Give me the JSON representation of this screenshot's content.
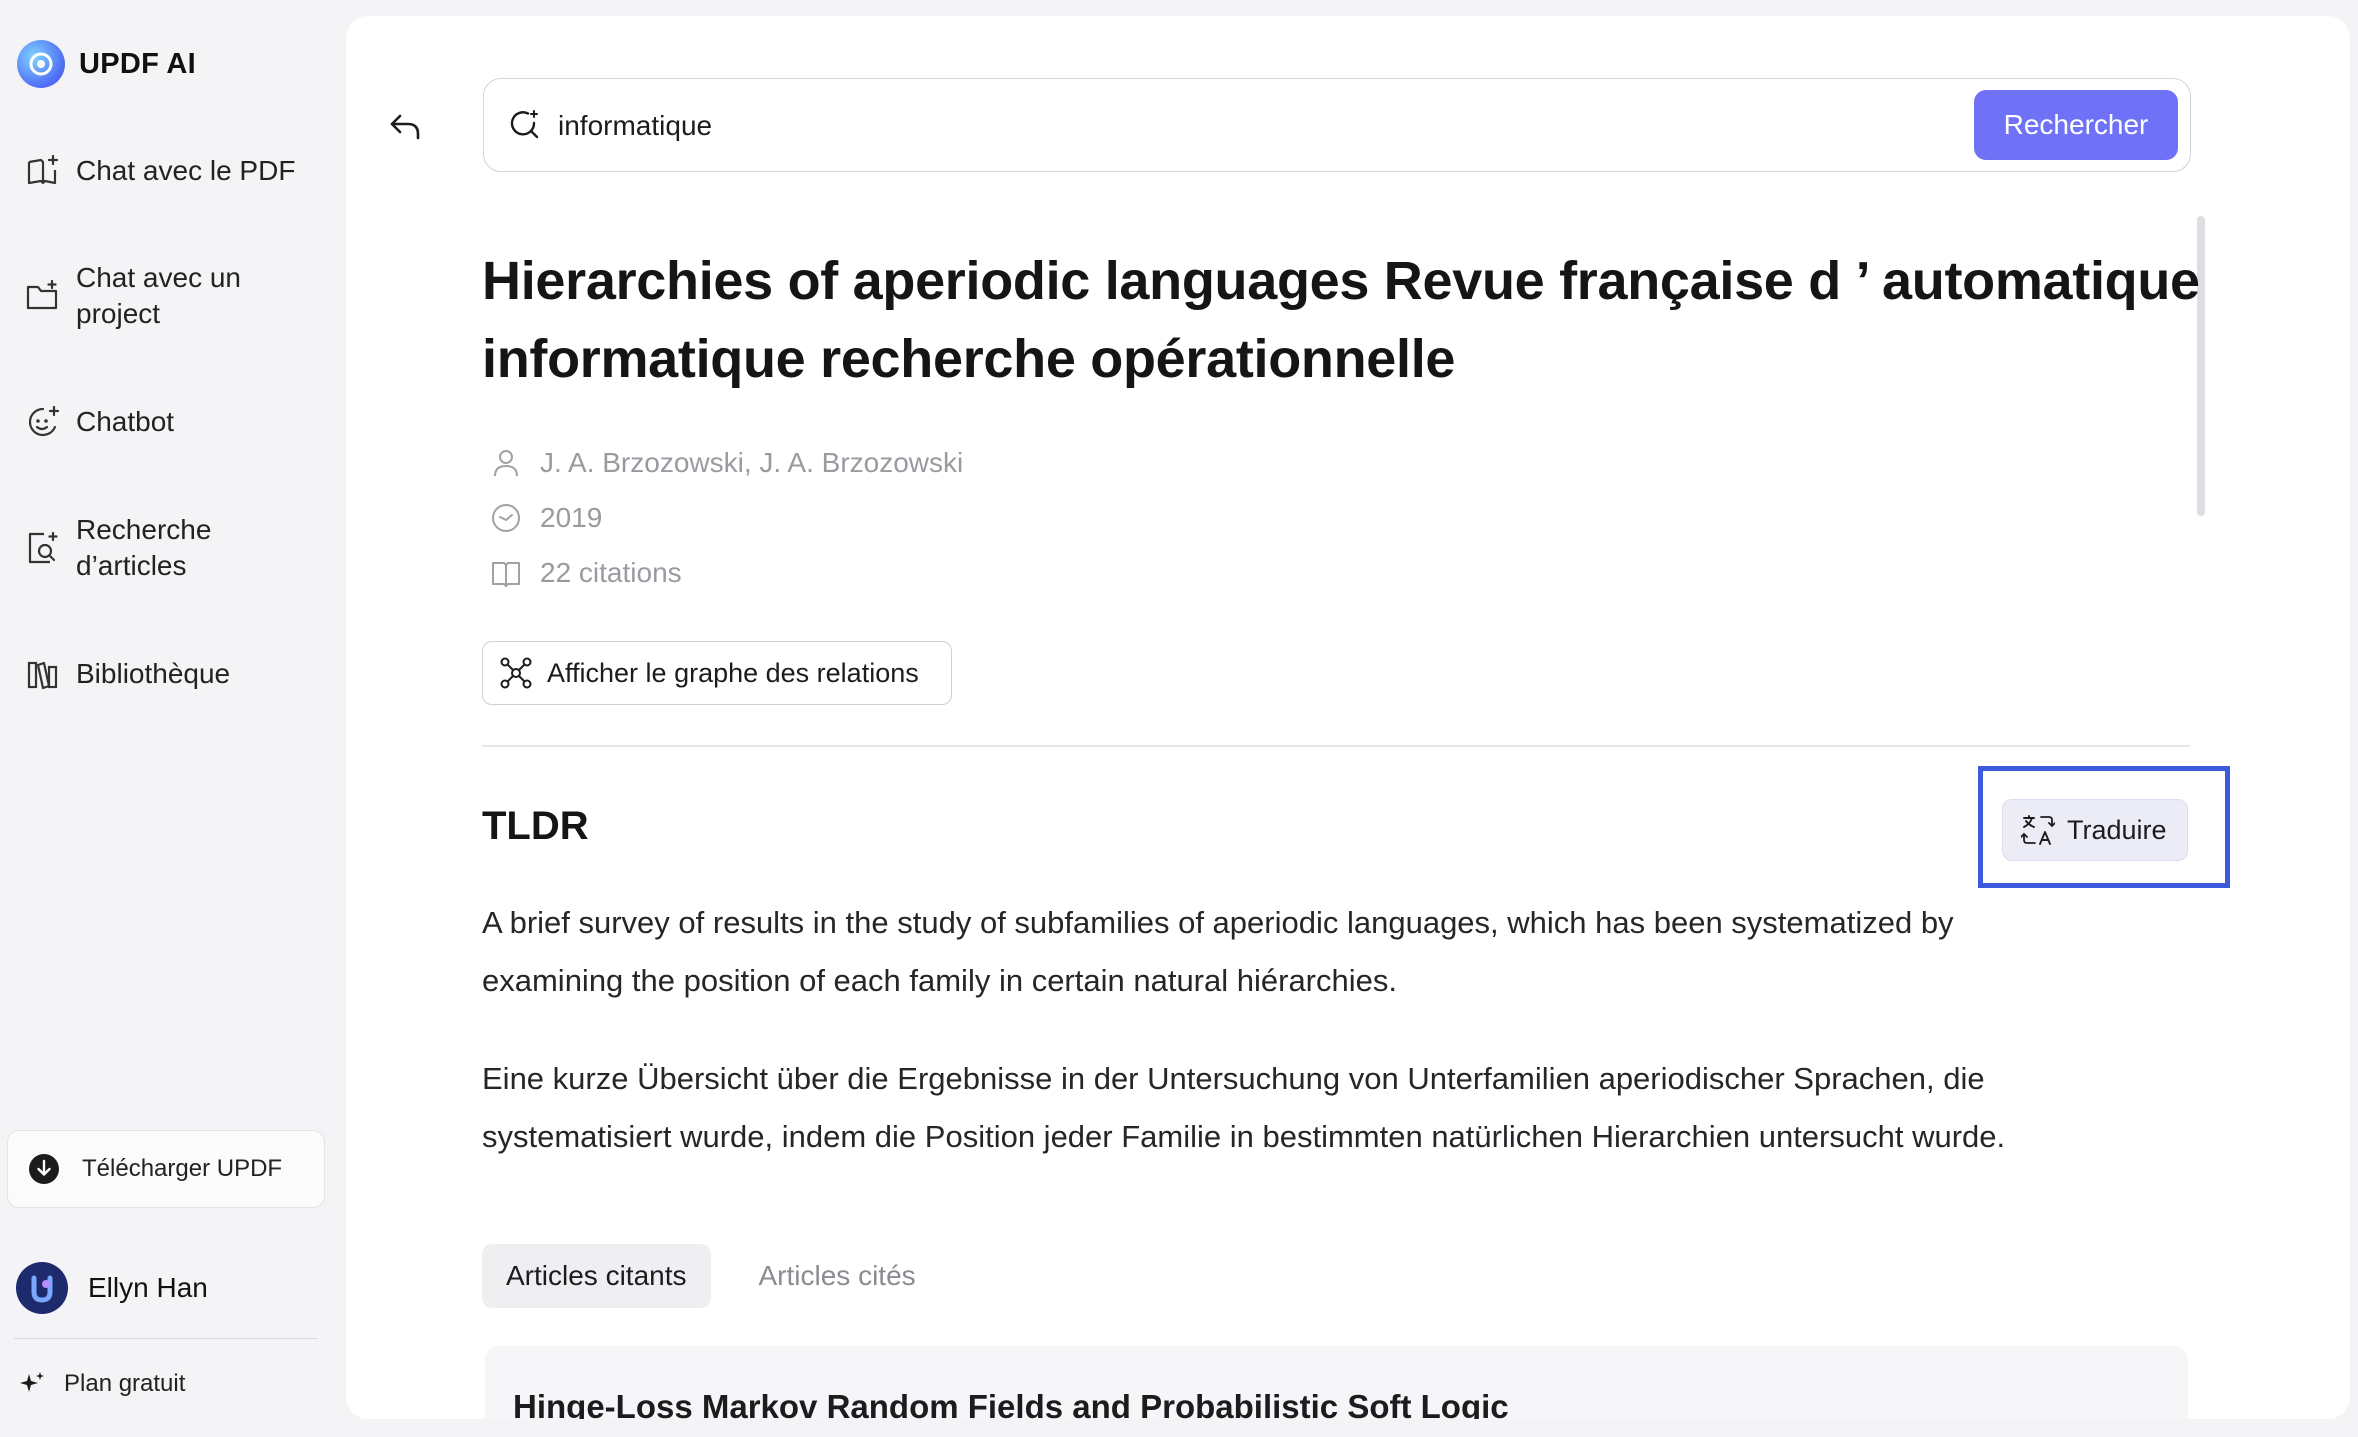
{
  "app": {
    "name": "UPDF AI"
  },
  "sidebar": {
    "items": [
      {
        "label": "Chat avec le PDF",
        "icon": "book-sparkle-icon"
      },
      {
        "label": "Chat avec un project",
        "icon": "folder-plus-icon"
      },
      {
        "label": "Chatbot",
        "icon": "chat-bot-icon"
      },
      {
        "label": "Recherche d’articles",
        "icon": "document-search-icon"
      },
      {
        "label": "Bibliothèque",
        "icon": "library-icon"
      }
    ],
    "download_label": "Télécharger UPDF",
    "user_name": "Ellyn Han",
    "plan_label": "Plan gratuit"
  },
  "search": {
    "value": "informatique",
    "button_label": "Rechercher"
  },
  "paper": {
    "title": "Hierarchies of aperiodic languages Revue française d ’ automatique informatique recherche opérationnelle",
    "authors": "J. A. Brzozowski,  J. A. Brzozowski",
    "year": "2019",
    "citations": "22 citations",
    "graph_button_label": "Afficher le graphe des relations"
  },
  "tldr": {
    "heading": "TLDR",
    "translate_label": "Traduire",
    "summary_en": "A brief survey of results in the study of subfamilies of aperiodic languages, which has been systematized by examining the position of each family in certain natural hiérarchies.",
    "summary_de": "Eine kurze Übersicht über die Ergebnisse in der Untersuchung von Unterfamilien aperiodischer Sprachen, die systematisiert wurde, indem die Position jeder Familie in bestimmten natürlichen Hierarchien untersucht wurde."
  },
  "tabs": [
    {
      "label": "Articles citants",
      "active": true
    },
    {
      "label": "Articles cités",
      "active": false
    }
  ],
  "results": [
    {
      "title": "Hinge-Loss Markov Random Fields and Probabilistic Soft Logic"
    }
  ],
  "colors": {
    "accent": "#6f72f7",
    "highlight_border": "#3b5bdb",
    "background": "#f4f4f6"
  }
}
